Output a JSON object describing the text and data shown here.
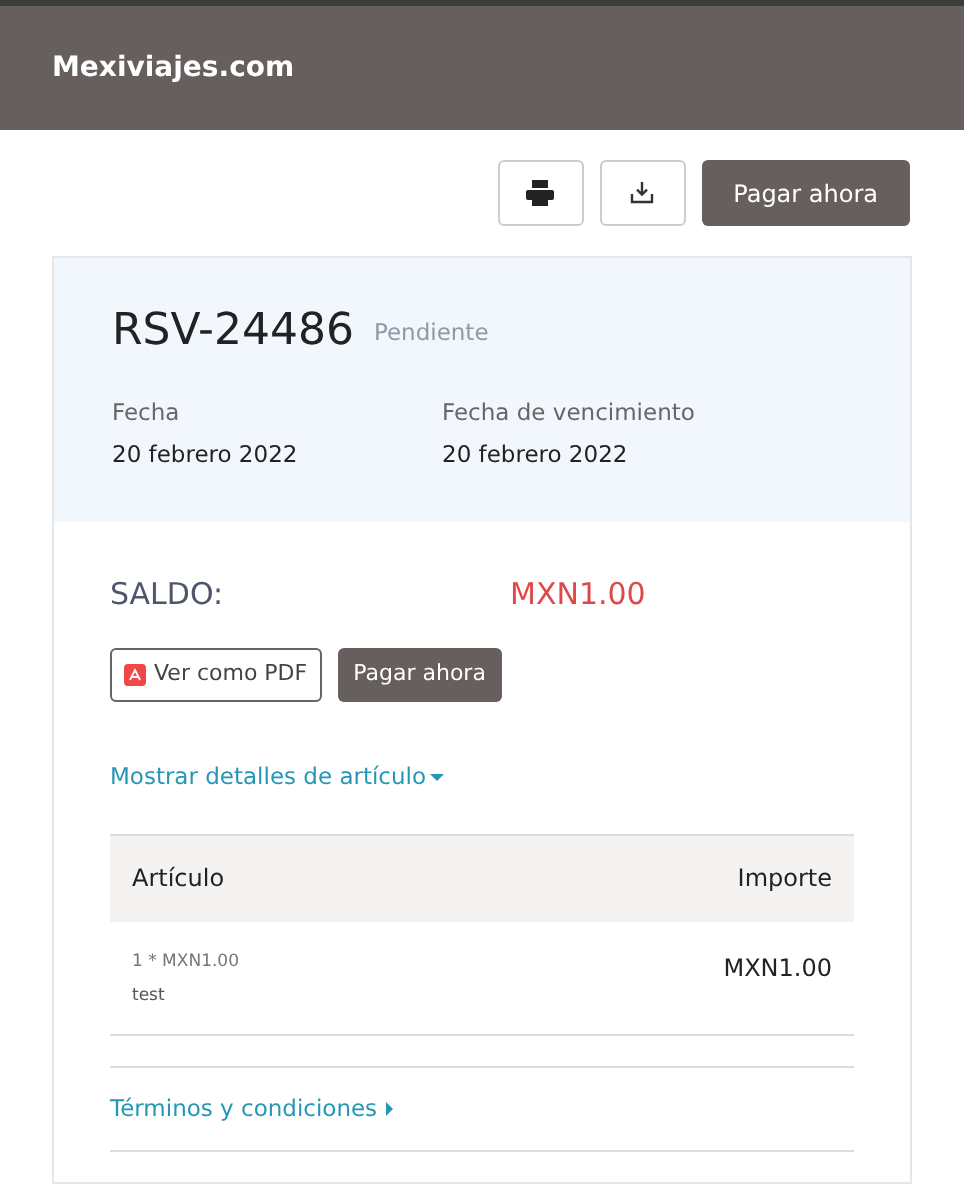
{
  "brand": "Mexiviajes.com",
  "toolbar": {
    "pay_button": "Pagar ahora"
  },
  "invoice": {
    "number": "RSV-24486",
    "status": "Pendiente",
    "dates": [
      {
        "label": "Fecha",
        "value": "20 febrero 2022"
      },
      {
        "label": "Fecha de vencimiento",
        "value": "20 febrero 2022"
      }
    ],
    "balance_label": "SALDO:",
    "balance": "MXN1.00",
    "pdf_button": "Ver como PDF",
    "pay_button": "Pagar ahora",
    "details_toggle": {
      "label": "Mostrar detalles de artículo",
      "expanded": true
    },
    "table": {
      "columns": [
        "Artículo",
        "Importe"
      ],
      "rows": [
        {
          "quantity_price": "1 * MXN1.00",
          "description": "test",
          "amount": "MXN1.00"
        }
      ]
    },
    "terms_toggle": {
      "label": "Términos y condiciones",
      "expanded": false
    }
  }
}
